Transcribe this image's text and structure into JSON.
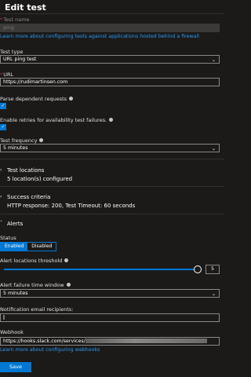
{
  "header": {
    "title": "Edit test"
  },
  "test_name": {
    "label": "Test name",
    "value": "ping"
  },
  "firewall_link": "Learn more about configuring tests against applications hosted behind a firewall",
  "test_type": {
    "label": "Test type",
    "value": "URL ping test"
  },
  "url": {
    "label": "URL",
    "value": "https://rudimartinsen.com"
  },
  "parse_dependent": {
    "label": "Parse dependent requests",
    "checked": true
  },
  "enable_retries": {
    "label": "Enable retries for availability test failures.",
    "checked": true
  },
  "test_frequency": {
    "label": "Test frequency",
    "value": "5 minutes"
  },
  "test_locations": {
    "title": "Test locations",
    "value": "5 location(s) configured"
  },
  "success_criteria": {
    "title": "Success criteria",
    "value": "HTTP response: 200, Test Timeout: 60 seconds"
  },
  "alerts": {
    "title": "Alerts",
    "status_label": "Status",
    "enabled_label": "Enabled",
    "disabled_label": "Disabled",
    "selected": "Enabled",
    "locations_threshold_label": "Alert locations threshold",
    "locations_threshold_value": "5",
    "failure_window_label": "Alert failure time window",
    "failure_window_value": "5 minutes",
    "email_label": "Notification email recipients:",
    "webhook_label": "Webhook",
    "webhook_value": "https://hooks.slack.com/services/",
    "webhook_link": "Learn more about configuring webhooks"
  },
  "footer": {
    "save_label": "Save"
  },
  "colors": {
    "accent": "#0078d4",
    "link": "#2899f5",
    "background": "#1b1a19",
    "required": "#d13438"
  }
}
